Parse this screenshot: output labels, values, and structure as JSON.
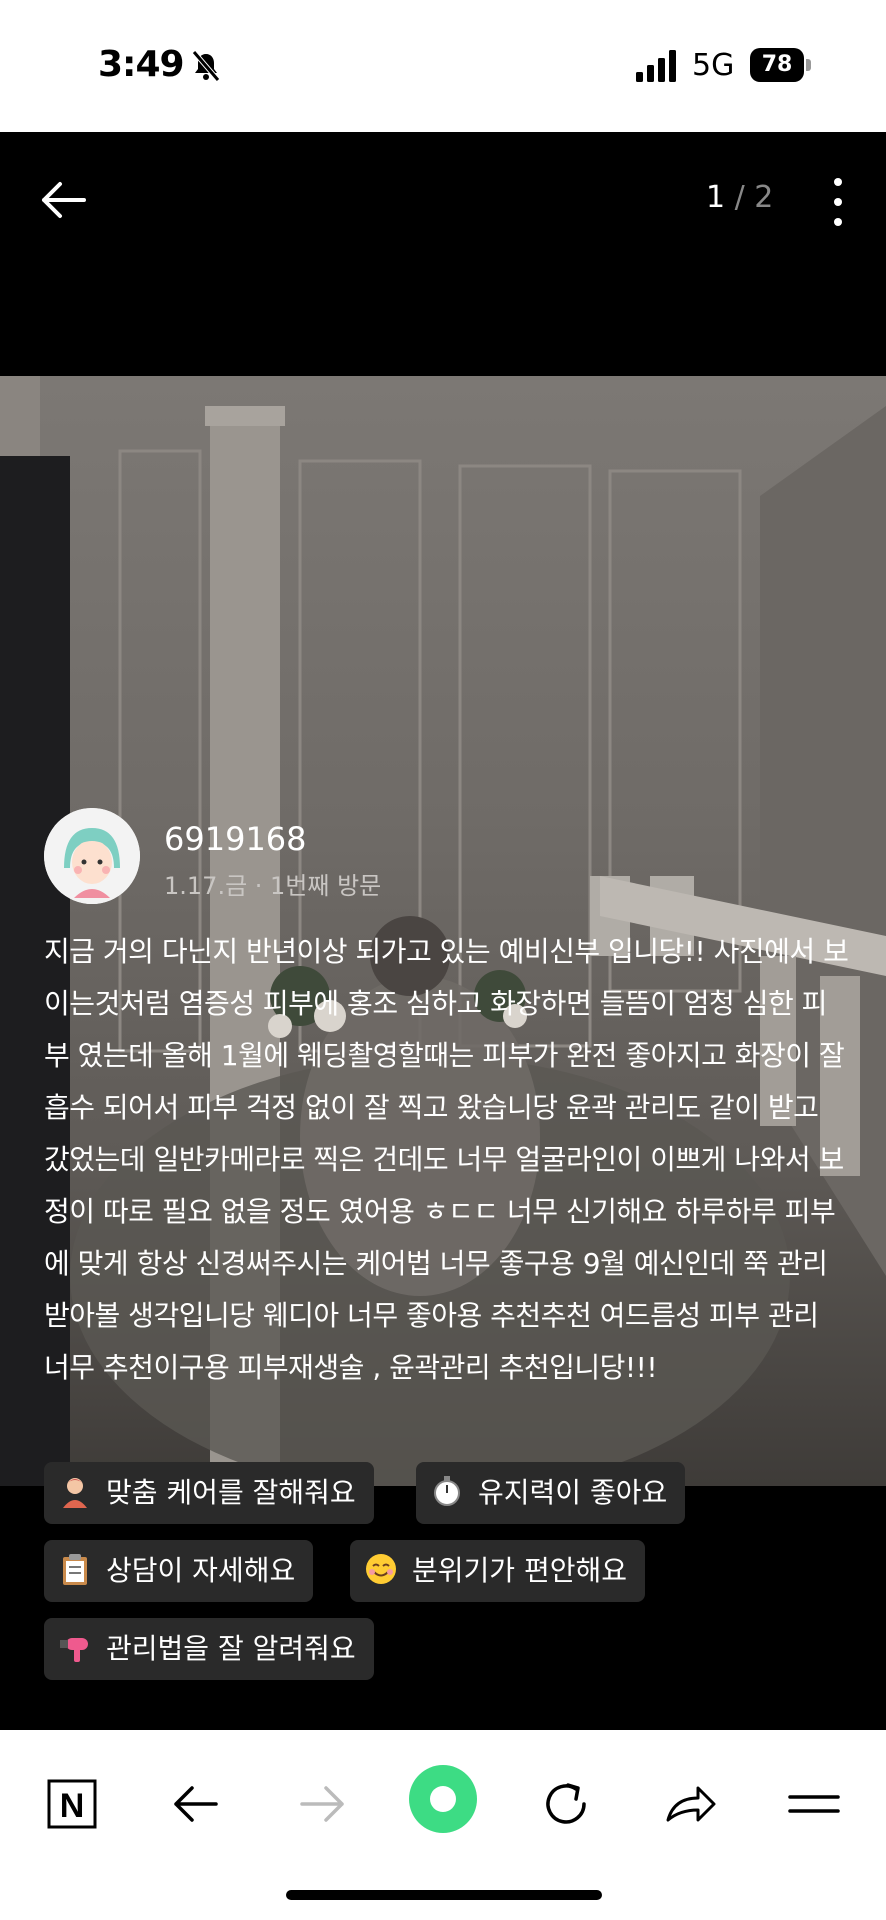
{
  "status_bar": {
    "time": "3:49",
    "network": "5G",
    "battery": "78"
  },
  "header": {
    "page_current": "1",
    "page_separator": "/",
    "page_total": "2"
  },
  "review": {
    "author": "6919168",
    "visit_meta": "1.17.금 · 1번째 방문",
    "text": "지금 거의 다닌지 반년이상 되가고 있는 예비신부 입니당!! 사진에서 보이는것처럼 염증성 피부에 홍조 심하고 화장하면 들뜸이 엄청 심한 피부 였는데 올해 1월에 웨딩촬영할때는 피부가 완전 좋아지고 화장이 잘 흡수 되어서 피부 걱정 없이 잘 찍고 왔습니당 윤곽 관리도 같이 받고 갔었는데 일반카메라로 찍은 건데도 너무 얼굴라인이 이쁘게 나와서 보정이 따로 필요 없을 정도 였어용 ㅎㄷㄷ 너무 신기해요 하루하루 피부에 맞게 항상 신경써주시는 케어법 너무 좋구용 9월 예신인데 쭉 관리 받아볼 생각입니당 웨디아 너무 좋아용 추천추천 여드름성 피부 관리 너무 추천이구용 피부재생술 , 윤곽관리 추천입니당!!!",
    "tags": [
      {
        "icon": "person-icon",
        "label": "맞춤 케어를 잘해줘요"
      },
      {
        "icon": "stopwatch-icon",
        "label": "유지력이 좋아요"
      },
      {
        "icon": "clipboard-icon",
        "label": "상담이 자세해요"
      },
      {
        "icon": "smile-icon",
        "label": "분위기가 편안해요"
      },
      {
        "icon": "hairdryer-icon",
        "label": "관리법을 잘 알려줘요"
      }
    ]
  },
  "bottom_bar": {
    "home_label": "N"
  },
  "colors": {
    "accent_green": "#3ddc84",
    "tag_background": "#2a2a2a"
  }
}
